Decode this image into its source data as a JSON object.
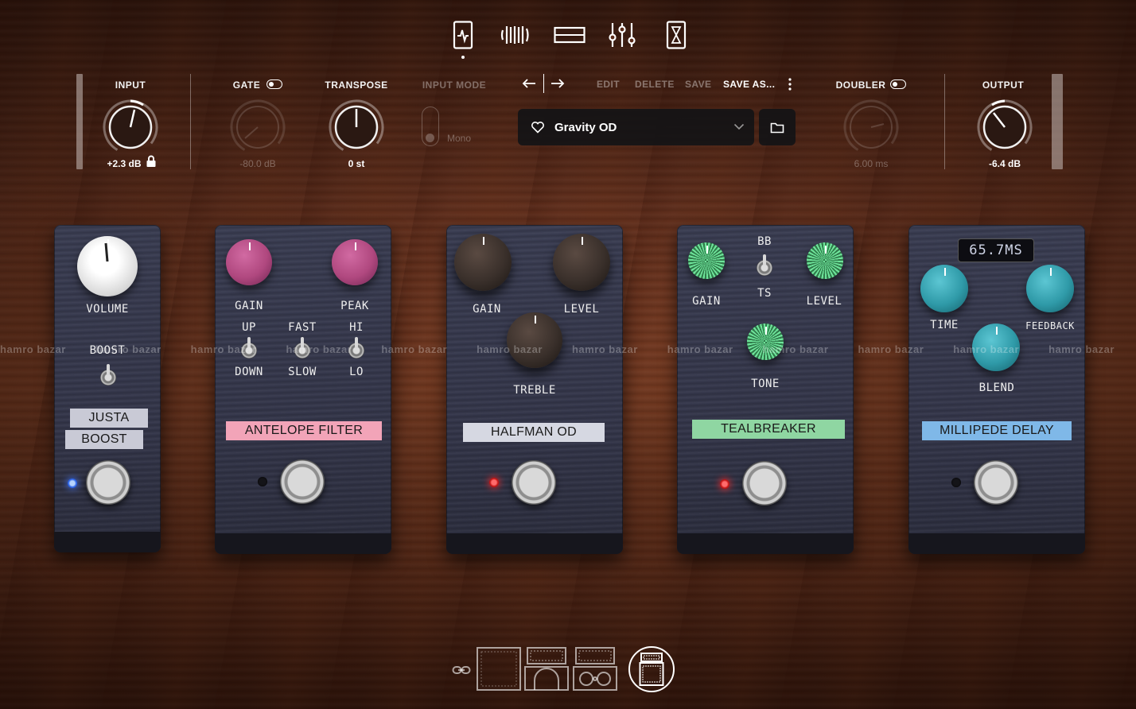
{
  "nav": {
    "tabs": [
      "tuner",
      "pedals",
      "amp",
      "mixer",
      "effects"
    ],
    "active": "pedals"
  },
  "controls": {
    "input": {
      "label": "INPUT",
      "value": "+2.3 dB"
    },
    "gate": {
      "label": "GATE",
      "value": "-80.0 dB"
    },
    "transpose": {
      "label": "TRANSPOSE",
      "value": "0 st"
    },
    "input_mode": {
      "label": "INPUT MODE",
      "value": "Mono"
    },
    "doubler": {
      "label": "DOUBLER",
      "value": "6.00 ms"
    },
    "output": {
      "label": "OUTPUT",
      "value": "-6.4 dB"
    }
  },
  "preset": {
    "edit": "EDIT",
    "delete": "DELETE",
    "save": "SAVE",
    "save_as": "SAVE AS...",
    "name": "Gravity OD"
  },
  "pedals": {
    "justa": {
      "volume": "VOLUME",
      "boost": "BOOST",
      "plate1": "JUSTA",
      "plate2": "BOOST"
    },
    "antelope": {
      "gain": "GAIN",
      "peak": "PEAK",
      "up": "UP",
      "down": "DOWN",
      "fast": "FAST",
      "slow": "SLOW",
      "hi": "HI",
      "lo": "LO",
      "plate": "ANTELOPE FILTER"
    },
    "halfman": {
      "gain": "GAIN",
      "level": "LEVEL",
      "treble": "TREBLE",
      "plate": "HALFMAN OD"
    },
    "tealbreaker": {
      "gain": "GAIN",
      "bb": "BB",
      "ts": "TS",
      "level": "LEVEL",
      "tone": "TONE",
      "plate": "TEALBREAKER"
    },
    "millipede": {
      "display": "65.7MS",
      "time": "TIME",
      "feedback": "FEEDBACK",
      "blend": "BLEND",
      "plate": "MILLIPEDE DELAY"
    }
  },
  "watermark": "hamro bazar",
  "colors": {
    "antelope_knob": "#b0487f",
    "antelope_plate": "#f2a4b8",
    "halfman_knob": "#3a302b",
    "halfman_plate": "#d6d8e2",
    "teal_knob": "#4ec27a",
    "teal_plate": "#8fd6a2",
    "milli_knob": "#2f9aa8",
    "milli_plate": "#7fb8e8"
  }
}
